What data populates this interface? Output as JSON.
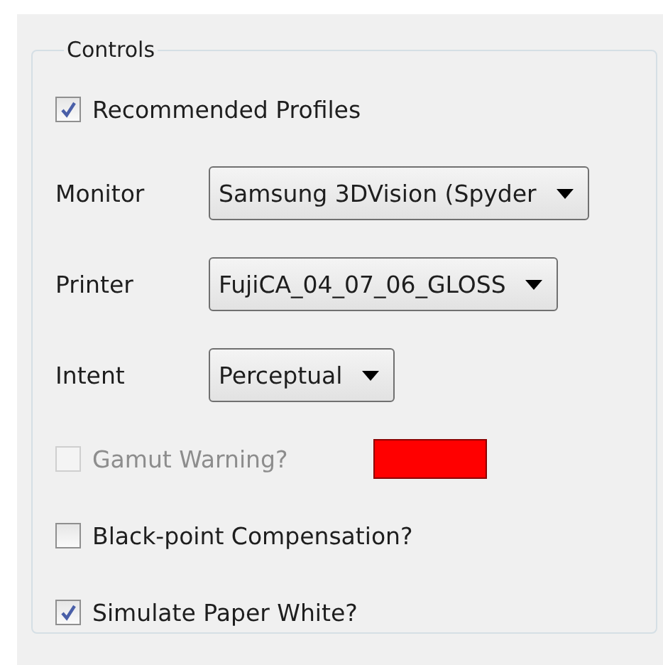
{
  "group": {
    "title": "Controls"
  },
  "rows": [
    {
      "kind": "checkbox",
      "label": "Recommended Profiles",
      "checked": true,
      "disabled": false
    },
    {
      "kind": "dropdown",
      "label": "Monitor",
      "value": "Samsung 3DVision (Spyder"
    },
    {
      "kind": "dropdown",
      "label": "Printer",
      "value": "FujiCA_04_07_06_GLOSS"
    },
    {
      "kind": "dropdown",
      "label": "Intent",
      "value": "Perceptual"
    },
    {
      "kind": "checkbox",
      "label": "Gamut Warning?",
      "checked": false,
      "disabled": true,
      "color": "#ff0000"
    },
    {
      "kind": "checkbox",
      "label": "Black-point Compensation?",
      "checked": false,
      "disabled": false
    },
    {
      "kind": "checkbox",
      "label": "Simulate Paper White?",
      "checked": true,
      "disabled": false
    }
  ]
}
